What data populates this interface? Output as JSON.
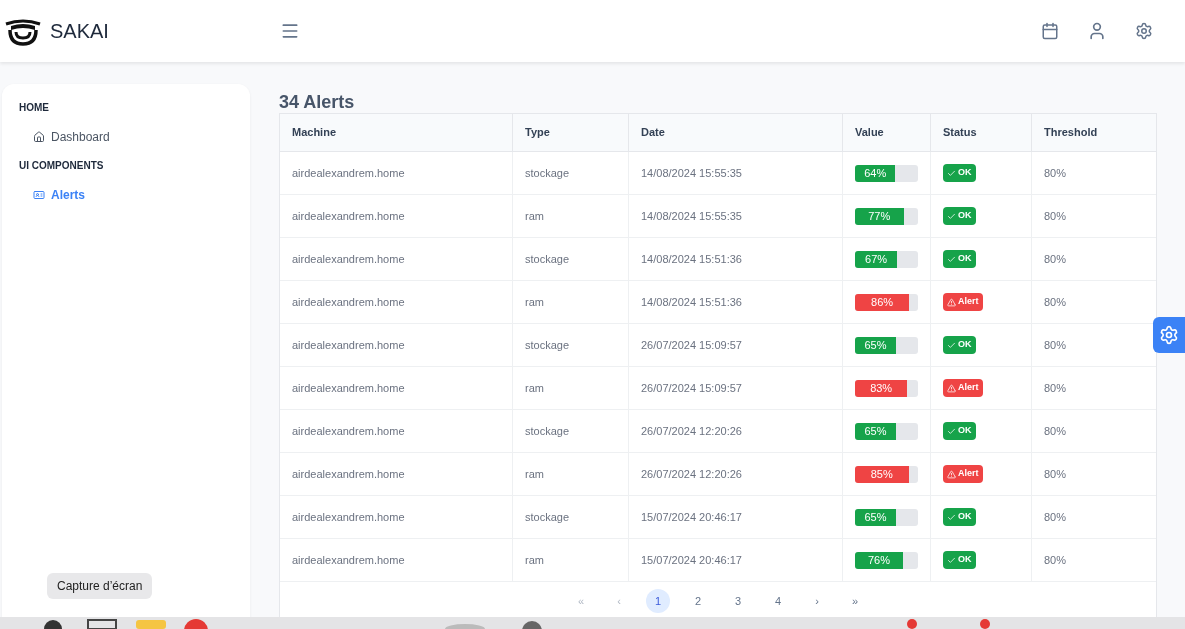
{
  "topbar": {
    "brand": "SAKAI"
  },
  "sidebar": {
    "sections": [
      {
        "title": "HOME",
        "items": [
          {
            "label": "Dashboard",
            "selected": false
          }
        ]
      },
      {
        "title": "UI COMPONENTS",
        "items": [
          {
            "label": "Alerts",
            "selected": true
          }
        ]
      }
    ]
  },
  "table": {
    "title": "34 Alerts",
    "columns": [
      "Machine",
      "Type",
      "Date",
      "Value",
      "Status",
      "Threshold"
    ],
    "rows": [
      {
        "machine": "airdealexandrem.home",
        "type": "stockage",
        "date": "14/08/2024 15:55:35",
        "value": "64%",
        "level": 0.64,
        "status": {
          "kind": "ok",
          "label": "OK"
        },
        "threshold": "80%"
      },
      {
        "machine": "airdealexandrem.home",
        "type": "ram",
        "date": "14/08/2024 15:55:35",
        "value": "77%",
        "level": 0.77,
        "status": {
          "kind": "ok",
          "label": "OK"
        },
        "threshold": "80%"
      },
      {
        "machine": "airdealexandrem.home",
        "type": "stockage",
        "date": "14/08/2024 15:51:36",
        "value": "67%",
        "level": 0.67,
        "status": {
          "kind": "ok",
          "label": "OK"
        },
        "threshold": "80%"
      },
      {
        "machine": "airdealexandrem.home",
        "type": "ram",
        "date": "14/08/2024 15:51:36",
        "value": "86%",
        "level": 0.86,
        "status": {
          "kind": "alert",
          "label": "Alert"
        },
        "threshold": "80%"
      },
      {
        "machine": "airdealexandrem.home",
        "type": "stockage",
        "date": "26/07/2024 15:09:57",
        "value": "65%",
        "level": 0.65,
        "status": {
          "kind": "ok",
          "label": "OK"
        },
        "threshold": "80%"
      },
      {
        "machine": "airdealexandrem.home",
        "type": "ram",
        "date": "26/07/2024 15:09:57",
        "value": "83%",
        "level": 0.83,
        "status": {
          "kind": "alert",
          "label": "Alert"
        },
        "threshold": "80%"
      },
      {
        "machine": "airdealexandrem.home",
        "type": "stockage",
        "date": "26/07/2024 12:20:26",
        "value": "65%",
        "level": 0.65,
        "status": {
          "kind": "ok",
          "label": "OK"
        },
        "threshold": "80%"
      },
      {
        "machine": "airdealexandrem.home",
        "type": "ram",
        "date": "26/07/2024 12:20:26",
        "value": "85%",
        "level": 0.85,
        "status": {
          "kind": "alert",
          "label": "Alert"
        },
        "threshold": "80%"
      },
      {
        "machine": "airdealexandrem.home",
        "type": "stockage",
        "date": "15/07/2024 20:46:17",
        "value": "65%",
        "level": 0.65,
        "status": {
          "kind": "ok",
          "label": "OK"
        },
        "threshold": "80%"
      },
      {
        "machine": "airdealexandrem.home",
        "type": "ram",
        "date": "15/07/2024 20:46:17",
        "value": "76%",
        "level": 0.76,
        "status": {
          "kind": "ok",
          "label": "OK"
        },
        "threshold": "80%"
      }
    ]
  },
  "pagination": {
    "first": "«",
    "prev": "‹",
    "pages": [
      {
        "label": "1",
        "selected": true
      },
      {
        "label": "2",
        "selected": false
      },
      {
        "label": "3",
        "selected": false
      },
      {
        "label": "4",
        "selected": false
      }
    ],
    "next": "›",
    "last": "»"
  },
  "tooltip": "Capture d’écran"
}
